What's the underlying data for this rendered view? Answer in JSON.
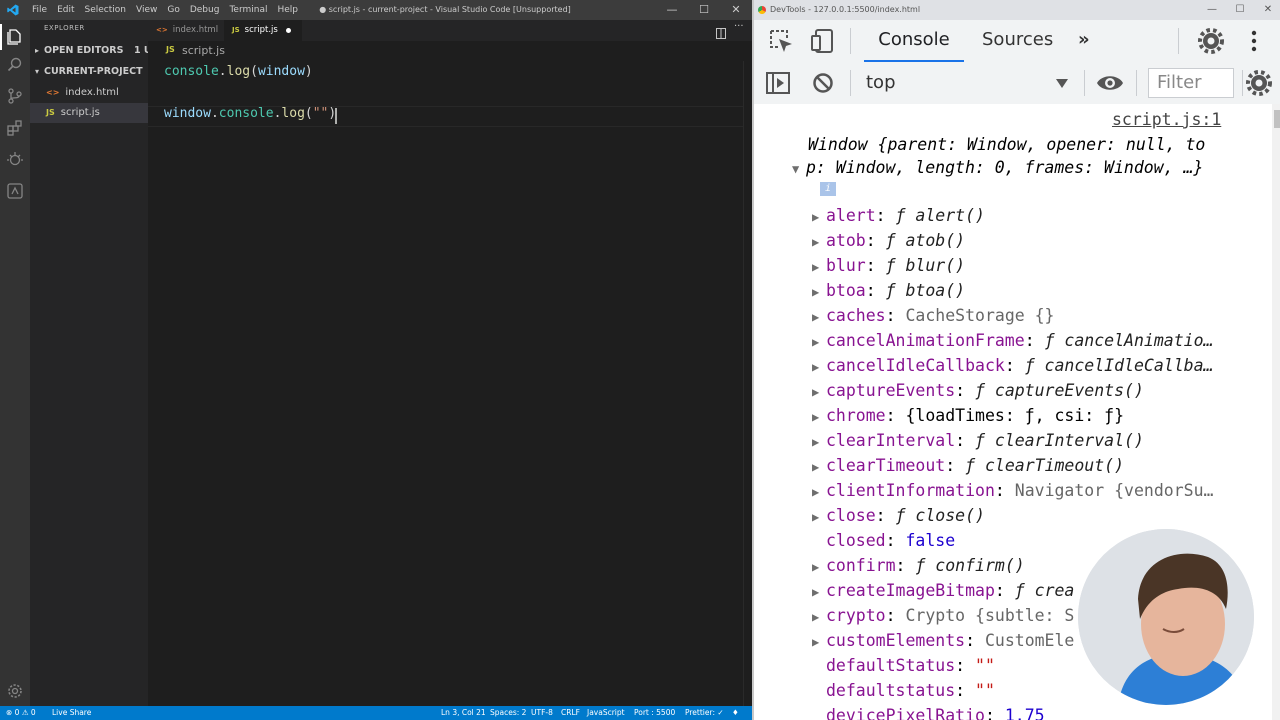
{
  "vscode": {
    "menu": [
      "File",
      "Edit",
      "Selection",
      "View",
      "Go",
      "Debug",
      "Terminal",
      "Help"
    ],
    "window_title": "● script.js - current-project - Visual Studio Code [Unsupported]",
    "window_controls": [
      "—",
      "☐",
      "✕"
    ],
    "explorer_header": "EXPLORER",
    "open_editors": "OPEN EDITORS",
    "open_editors_badge": "1 U",
    "project": "CURRENT-PROJECT",
    "files": [
      {
        "icon": "<>",
        "name": "index.html"
      },
      {
        "icon": "JS",
        "name": "script.js"
      }
    ],
    "tabs": [
      {
        "icon": "<>",
        "name": "index.html"
      },
      {
        "icon": "JS",
        "name": "script.js"
      }
    ],
    "breadcrumb": {
      "icon": "JS",
      "file": "script.js"
    },
    "code": {
      "line1": {
        "obj": "console",
        "dot": ".",
        "fn": "log",
        "open": "(",
        "arg": "window",
        "close": ")"
      },
      "line3": {
        "obj": "window",
        "dot1": ".",
        "obj2": "console",
        "dot2": ".",
        "fn": "log",
        "open": "(",
        "str": "\"\"",
        "close": ")"
      }
    },
    "status": {
      "problems": "⊗ 0 ⚠ 0",
      "live_share": "Live Share",
      "position": "Ln 3, Col 21",
      "spaces": "Spaces: 2",
      "encoding": "UTF-8",
      "eol": "CRLF",
      "language": "JavaScript",
      "port": "Port : 5500",
      "prettier": "Prettier: ✓"
    }
  },
  "devtools": {
    "title": "DevTools - 127.0.0.1:5500/index.html",
    "tabs": [
      "Console",
      "Sources",
      "»"
    ],
    "context": "top",
    "filter_placeholder": "Filter",
    "source_link": "script.js:1",
    "summary_line1": "Window {parent: Window, opener: null, to",
    "summary_line2": "p: Window, length: 0, frames: Window, …}",
    "info_badge": "i",
    "properties": [
      {
        "key": "alert",
        "value": "ƒ alert()",
        "type": "fn",
        "expand": true
      },
      {
        "key": "atob",
        "value": "ƒ atob()",
        "type": "fn",
        "expand": true
      },
      {
        "key": "blur",
        "value": "ƒ blur()",
        "type": "fn",
        "expand": true
      },
      {
        "key": "btoa",
        "value": "ƒ btoa()",
        "type": "fn",
        "expand": true
      },
      {
        "key": "caches",
        "value": "CacheStorage {}",
        "type": "obj",
        "expand": true
      },
      {
        "key": "cancelAnimationFrame",
        "value": "ƒ cancelAnimatio…",
        "type": "fn",
        "expand": true
      },
      {
        "key": "cancelIdleCallback",
        "value": "ƒ cancelIdleCallba…",
        "type": "fn",
        "expand": true
      },
      {
        "key": "captureEvents",
        "value": "ƒ captureEvents()",
        "type": "fn",
        "expand": true
      },
      {
        "key": "chrome",
        "value": "{loadTimes: ƒ, csi: ƒ}",
        "type": "plain",
        "expand": true
      },
      {
        "key": "clearInterval",
        "value": "ƒ clearInterval()",
        "type": "fn",
        "expand": true
      },
      {
        "key": "clearTimeout",
        "value": "ƒ clearTimeout()",
        "type": "fn",
        "expand": true
      },
      {
        "key": "clientInformation",
        "value": "Navigator {vendorSu…",
        "type": "obj",
        "expand": true
      },
      {
        "key": "close",
        "value": "ƒ close()",
        "type": "fn",
        "expand": true
      },
      {
        "key": "closed",
        "value": "false",
        "type": "bool",
        "expand": false
      },
      {
        "key": "confirm",
        "value": "ƒ confirm()",
        "type": "fn",
        "expand": true
      },
      {
        "key": "createImageBitmap",
        "value": "ƒ crea",
        "type": "fn",
        "expand": true
      },
      {
        "key": "crypto",
        "value": "Crypto {subtle: S",
        "type": "obj",
        "expand": true
      },
      {
        "key": "customElements",
        "value": "CustomEle",
        "type": "obj",
        "expand": true
      },
      {
        "key": "defaultStatus",
        "value": "\"\"",
        "type": "str",
        "expand": false
      },
      {
        "key": "defaultstatus",
        "value": "\"\"",
        "type": "str",
        "expand": false
      },
      {
        "key": "devicePixelRatio",
        "value": "1.75",
        "type": "num",
        "expand": false
      }
    ]
  }
}
